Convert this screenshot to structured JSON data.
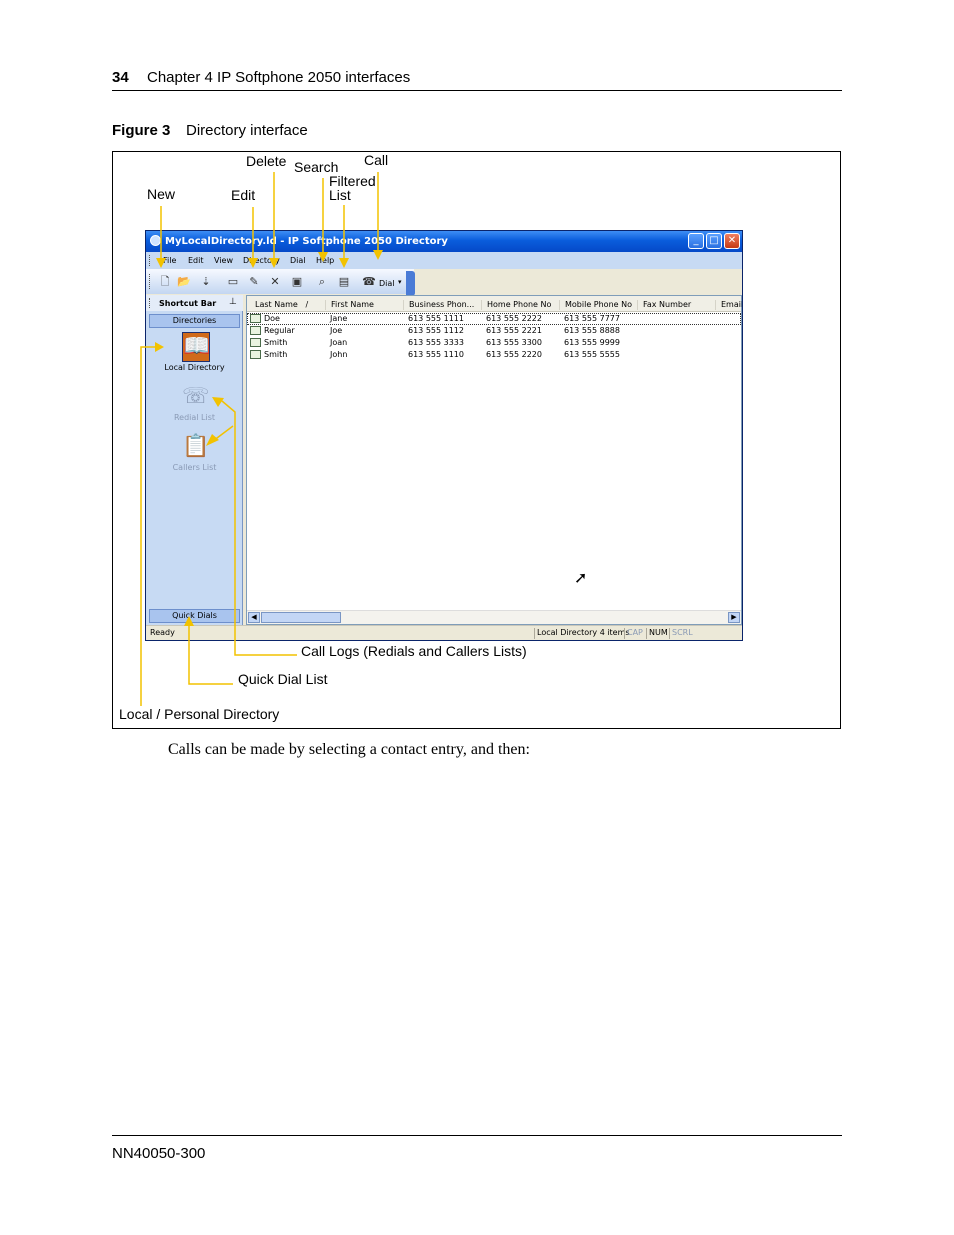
{
  "page": {
    "page_number": "34",
    "chapter_title": "Chapter 4  IP Softphone 2050 interfaces",
    "figure_label": "Figure 3",
    "figure_title": "Directory interface",
    "body_text": "Calls can be made by selecting a contact entry, and then:",
    "doc_number": "NN40050-300"
  },
  "callouts": {
    "new": "New",
    "edit": "Edit",
    "delete": "Delete",
    "search": "Search",
    "filtered_list_1": "Filtered",
    "filtered_list_2": "List",
    "call": "Call",
    "call_logs": "Call Logs (Redials and Callers Lists)",
    "quick_dial_list": "Quick Dial List",
    "local_directory": "Local / Personal Directory",
    "arrow_color": "#f2c200"
  },
  "window": {
    "title": "MyLocalDirectory.ld - IP Softphone 2050 Directory",
    "menu": [
      "File",
      "Edit",
      "View",
      "Directory",
      "Dial",
      "Help"
    ],
    "toolbar_dial": "Dial",
    "title_bar_color": "#0a5ddc",
    "icon_color": "#d06a1a"
  },
  "shortcut_bar": {
    "title": "Shortcut Bar",
    "group": "Directories",
    "items": [
      "Local Directory",
      "Redial List",
      "Callers List"
    ],
    "bottom_tab": "Quick Dials"
  },
  "list": {
    "columns": [
      "Last Name",
      "First Name",
      "Business Phon...",
      "Home Phone No",
      "Mobile Phone No",
      "Fax Number",
      "Email"
    ],
    "rows": [
      [
        "Doe",
        "Jane",
        "613 555 1111",
        "613 555 2222",
        "613 555 7777"
      ],
      [
        "Regular",
        "Joe",
        "613 555 1112",
        "613 555 2221",
        "613 555 8888"
      ],
      [
        "Smith",
        "Joan",
        "613 555 3333",
        "613 555 3300",
        "613 555 9999"
      ],
      [
        "Smith",
        "John",
        "613 555 1110",
        "613 555 2220",
        "613 555 5555"
      ]
    ]
  },
  "status": {
    "ready": "Ready",
    "directory_count": "Local Directory 4 items",
    "cap": "CAP",
    "num": "NUM",
    "scrl": "SCRL"
  }
}
